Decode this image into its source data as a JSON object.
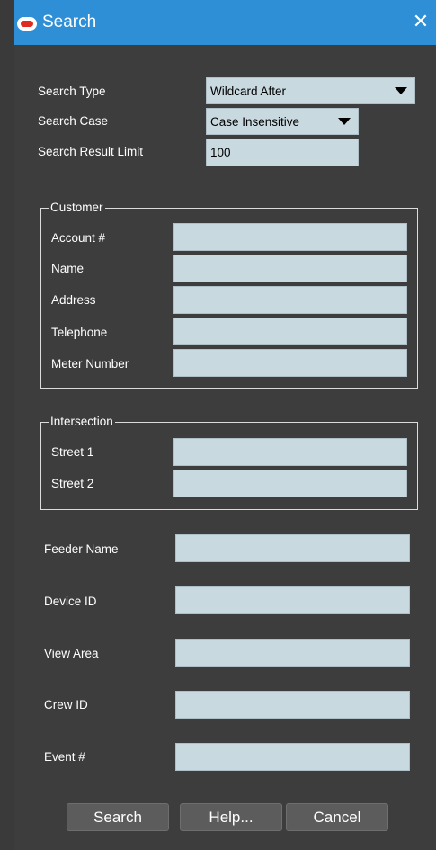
{
  "window": {
    "title": "Search",
    "close_label": "✕"
  },
  "search_options": {
    "search_type_label": "Search Type",
    "search_type_value": "Wildcard After",
    "search_case_label": "Search Case",
    "search_case_value": "Case Insensitive",
    "result_limit_label": "Search Result Limit",
    "result_limit_value": "100"
  },
  "customer": {
    "legend": "Customer",
    "account_label": "Account #",
    "name_label": "Name",
    "address_label": "Address",
    "telephone_label": "Telephone",
    "meter_label": "Meter Number"
  },
  "intersection": {
    "legend": "Intersection",
    "street1_label": "Street 1",
    "street2_label": "Street 2"
  },
  "other": {
    "feeder_label": "Feeder Name",
    "device_label": "Device ID",
    "view_area_label": "View Area",
    "crew_label": "Crew ID",
    "event_label": "Event #"
  },
  "buttons": {
    "search": "Search",
    "help": "Help...",
    "cancel": "Cancel"
  },
  "colors": {
    "title_bar": "#2f8fd6",
    "dialog_bg": "#3d3d3d",
    "field_bg": "#c9d9e0",
    "logo": "#e02b20"
  }
}
